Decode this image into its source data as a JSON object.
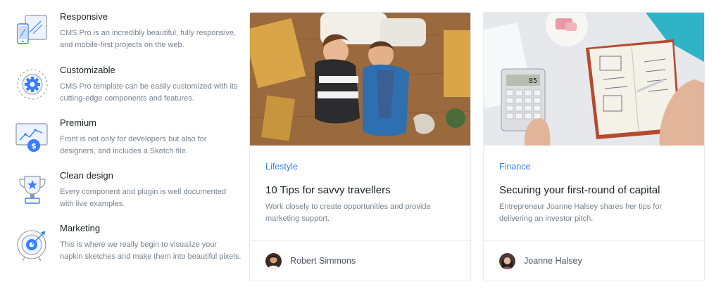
{
  "features": [
    {
      "icon": "responsive-devices-icon",
      "title": "Responsive",
      "text": "CMS Pro is an incredibly beautiful, fully responsive, and mobile-first projects on the web."
    },
    {
      "icon": "gear-customize-icon",
      "title": "Customizable",
      "text": "CMS Pro template can be easily customized with its cutting-edge components and features."
    },
    {
      "icon": "chart-dollar-icon",
      "title": "Premium",
      "text": "Front is not only for developers but also for designers, and includes a Sketch file."
    },
    {
      "icon": "trophy-icon",
      "title": "Clean design",
      "text": "Every component and plugin is well documented with live examples."
    },
    {
      "icon": "target-icon",
      "title": "Marketing",
      "text": "This is where we really begin to visualize your napkin sketches and make them into beautiful pixels."
    }
  ],
  "cards": [
    {
      "category": "Lifestyle",
      "title": "10 Tips for savvy travellers",
      "excerpt": "Work closely to create opportunities and provide marketing support.",
      "author": "Robert Simmons"
    },
    {
      "category": "Finance",
      "title": "Securing your first-round of capital",
      "excerpt": "Entrepreneur Joanne Halsey shares her tips for delivering an investor pitch.",
      "author": "Joanne Halsey"
    }
  ],
  "colors": {
    "accent": "#377dff",
    "heading": "#1e2022",
    "muted": "#77838f",
    "border": "#e7eaf3"
  },
  "calculator_display": "85"
}
